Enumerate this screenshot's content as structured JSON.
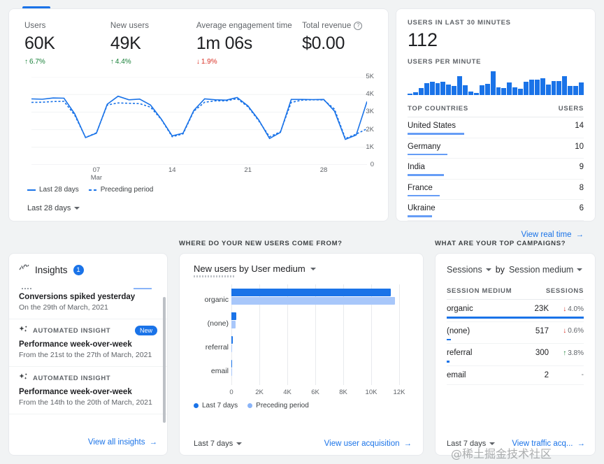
{
  "overview": {
    "metrics": [
      {
        "label": "Users",
        "value": "60K",
        "delta": "6.7%",
        "direction": "up"
      },
      {
        "label": "New users",
        "value": "49K",
        "delta": "4.4%",
        "direction": "up"
      },
      {
        "label": "Average engagement time",
        "value": "1m 06s",
        "delta": "1.9%",
        "direction": "down"
      },
      {
        "label": "Total revenue",
        "value": "$0.00",
        "delta": "",
        "direction": "none",
        "help": "?"
      }
    ],
    "legend": [
      {
        "label": "Last 28 days",
        "style": "solid"
      },
      {
        "label": "Preceding period",
        "style": "dashed"
      }
    ],
    "date_range": "Last 28 days"
  },
  "chart_data": [
    {
      "type": "line",
      "title": "Users over last 28 days",
      "xlabel": "",
      "ylabel": "",
      "ylim": [
        0,
        5000
      ],
      "yticks": [
        "0",
        "1K",
        "2K",
        "3K",
        "4K",
        "5K"
      ],
      "xticks": [
        {
          "label": "07",
          "sub": "Mar",
          "index": 6
        },
        {
          "label": "14",
          "sub": "",
          "index": 13
        },
        {
          "label": "21",
          "sub": "",
          "index": 20
        },
        {
          "label": "28",
          "sub": "",
          "index": 27
        }
      ],
      "grid": true,
      "legend_position": "bottom-left",
      "series": [
        {
          "name": "Last 28 days",
          "style": "solid",
          "values": [
            3750,
            3730,
            3800,
            3790,
            2900,
            1550,
            1800,
            3450,
            3900,
            3700,
            3740,
            3400,
            2600,
            1650,
            1800,
            3100,
            3750,
            3700,
            3680,
            3830,
            3350,
            2550,
            1500,
            1850,
            3720,
            3720,
            3710,
            3720,
            3050,
            1450,
            1700,
            3600
          ]
        },
        {
          "name": "Preceding period",
          "style": "dashed",
          "values": [
            3550,
            3560,
            3600,
            3610,
            2820,
            1560,
            1820,
            3400,
            3520,
            3500,
            3480,
            3280,
            2580,
            1600,
            1760,
            3050,
            3560,
            3640,
            3640,
            3760,
            3300,
            2500,
            1600,
            1880,
            3550,
            3680,
            3700,
            3690,
            3170,
            1500,
            1750,
            2050
          ]
        }
      ]
    },
    {
      "type": "bar",
      "orientation": "vertical",
      "title": "Users per minute",
      "xlabel": "",
      "ylabel": "",
      "categories": [
        "1",
        "2",
        "3",
        "4",
        "5",
        "6",
        "7",
        "8",
        "9",
        "10",
        "11",
        "12",
        "13",
        "14",
        "15",
        "16",
        "17",
        "18",
        "19",
        "20",
        "21",
        "22",
        "23",
        "24",
        "25",
        "26",
        "27",
        "28",
        "29",
        "30"
      ],
      "values": [
        3,
        10,
        22,
        38,
        44,
        40,
        44,
        35,
        30,
        62,
        32,
        11,
        7,
        33,
        37,
        78,
        26,
        22,
        41,
        26,
        21,
        43,
        50,
        50,
        54,
        34,
        46,
        47,
        63,
        30,
        29,
        41
      ],
      "grid": false
    },
    {
      "type": "bar",
      "orientation": "horizontal",
      "title": "New users by User medium",
      "categories": [
        "organic",
        "(none)",
        "referral",
        "email"
      ],
      "xlim": [
        0,
        12000
      ],
      "xticks": [
        "0",
        "2K",
        "4K",
        "6K",
        "8K",
        "10K",
        "12K"
      ],
      "grid": true,
      "legend_position": "bottom",
      "series": [
        {
          "name": "Last 7 days",
          "values": [
            11400,
            330,
            95,
            6
          ]
        },
        {
          "name": "Preceding period",
          "values": [
            11700,
            300,
            70,
            4
          ]
        }
      ]
    }
  ],
  "realtime": {
    "users_caption": "USERS IN LAST 30 MINUTES",
    "users_count": "112",
    "per_minute_caption": "USERS PER MINUTE",
    "table": {
      "col_dimension": "TOP COUNTRIES",
      "col_metric": "USERS",
      "rows": [
        {
          "name": "United States",
          "value": "14",
          "bar_pct": 100
        },
        {
          "name": "Germany",
          "value": "10",
          "bar_pct": 71
        },
        {
          "name": "India",
          "value": "9",
          "bar_pct": 64
        },
        {
          "name": "France",
          "value": "8",
          "bar_pct": 57
        },
        {
          "name": "Ukraine",
          "value": "6",
          "bar_pct": 43
        }
      ]
    },
    "footer_link": "View real time"
  },
  "sections": {
    "new_users_caption": "WHERE DO YOUR NEW USERS COME FROM?",
    "campaigns_caption": "WHAT ARE YOUR TOP CAMPAIGNS?"
  },
  "insights": {
    "title": "Insights",
    "badge": "1",
    "items": [
      {
        "kicker": "",
        "pill": "",
        "heading": "Conversions spiked yesterday",
        "sub": "On the 29th of March, 2021",
        "has_spark": true
      },
      {
        "kicker": "AUTOMATED INSIGHT",
        "pill": "New",
        "heading": "Performance week-over-week",
        "sub": "From the 21st to the 27th of March, 2021",
        "has_spark": false
      },
      {
        "kicker": "AUTOMATED INSIGHT",
        "pill": "",
        "heading": "Performance week-over-week",
        "sub": "From the 14th to the 20th of March, 2021",
        "has_spark": false
      }
    ],
    "footer_link": "View all insights"
  },
  "new_users_panel": {
    "title": "New users by User medium",
    "legend": [
      {
        "label": "Last 7 days",
        "color": "#1a73e8"
      },
      {
        "label": "Preceding period",
        "color": "#8ab4f8"
      }
    ],
    "date_range": "Last 7 days",
    "footer_link": "View user acquisition"
  },
  "campaigns_panel": {
    "metric_select": "Sessions",
    "by_text": "by",
    "dimension_select": "Session medium",
    "col_dimension": "SESSION MEDIUM",
    "col_metric": "SESSIONS",
    "rows": [
      {
        "name": "organic",
        "value": "23K",
        "change": "4.0%",
        "direction": "down",
        "bar_pct": 100
      },
      {
        "name": "(none)",
        "value": "517",
        "change": "0.6%",
        "direction": "down",
        "bar_pct": 3
      },
      {
        "name": "referral",
        "value": "300",
        "change": "3.8%",
        "direction": "up",
        "bar_pct": 2
      },
      {
        "name": "email",
        "value": "2",
        "change": "-",
        "direction": "none",
        "bar_pct": 0
      }
    ],
    "date_range": "Last 7 days",
    "footer_link": "View traffic acq..."
  },
  "watermark": "@稀土掘金技术社区",
  "colors": {
    "accent": "#1a73e8",
    "accent_light": "#a8c7fa",
    "up": "#188038",
    "down": "#d93025"
  }
}
